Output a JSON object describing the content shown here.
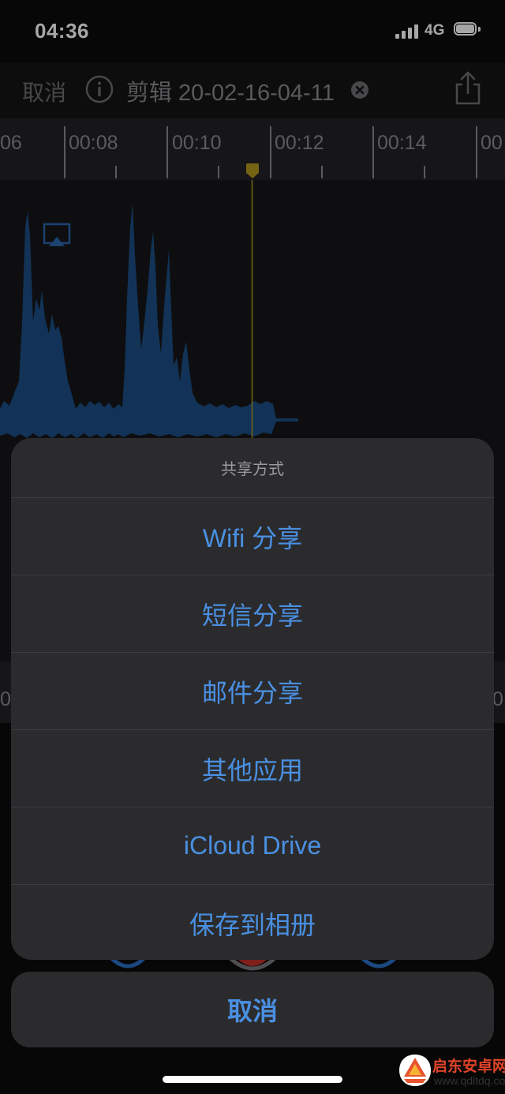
{
  "status_bar": {
    "time": "04:36",
    "network": "4G"
  },
  "header": {
    "cancel_label": "取消",
    "recording_title": "剪辑 20-02-16-04-11"
  },
  "timeline": {
    "labels": [
      "06",
      "00:08",
      "00:10",
      "00:12",
      "00:14",
      "00"
    ],
    "lower_labels": [
      "0",
      "0"
    ]
  },
  "share_sheet": {
    "title": "共享方式",
    "options": [
      "Wifi 分享",
      "短信分享",
      "邮件分享",
      "其他应用",
      "iCloud Drive",
      "保存到相册"
    ],
    "cancel_label": "取消"
  },
  "colors": {
    "accent": "#4a90e2",
    "waveform": "#1d4f86",
    "playhead": "#b39a1e",
    "record": "#c4302b"
  },
  "watermark": {
    "text": "启东安卓网",
    "url": "www.qdltdq.com"
  }
}
